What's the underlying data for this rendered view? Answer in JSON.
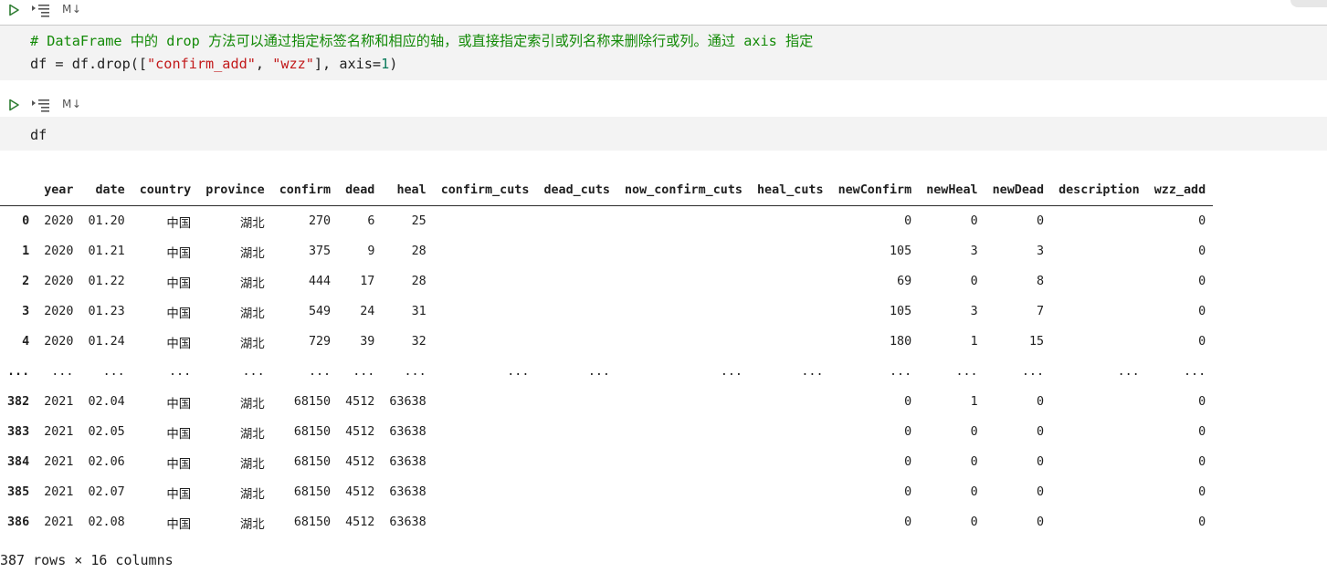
{
  "toolbar": {
    "md_label": "M↓"
  },
  "cell1": {
    "comment": "# DataFrame 中的 drop 方法可以通过指定标签名称和相应的轴，或直接指定索引或列名称来删除行或列。通过 axis 指定",
    "code_prefix": "df = df.drop([",
    "str1": "\"confirm_add\"",
    "sep": ", ",
    "str2": "\"wzz\"",
    "code_mid": "], axis=",
    "num": "1",
    "code_end": ")"
  },
  "cell2": {
    "code": "df"
  },
  "table": {
    "columns": [
      "",
      "year",
      "date",
      "country",
      "province",
      "confirm",
      "dead",
      "heal",
      "confirm_cuts",
      "dead_cuts",
      "now_confirm_cuts",
      "heal_cuts",
      "newConfirm",
      "newHeal",
      "newDead",
      "description",
      "wzz_add"
    ],
    "rows": [
      [
        "0",
        "2020",
        "01.20",
        "中国",
        "湖北",
        "270",
        "6",
        "25",
        "",
        "",
        "",
        "",
        "0",
        "0",
        "0",
        "",
        "0"
      ],
      [
        "1",
        "2020",
        "01.21",
        "中国",
        "湖北",
        "375",
        "9",
        "28",
        "",
        "",
        "",
        "",
        "105",
        "3",
        "3",
        "",
        "0"
      ],
      [
        "2",
        "2020",
        "01.22",
        "中国",
        "湖北",
        "444",
        "17",
        "28",
        "",
        "",
        "",
        "",
        "69",
        "0",
        "8",
        "",
        "0"
      ],
      [
        "3",
        "2020",
        "01.23",
        "中国",
        "湖北",
        "549",
        "24",
        "31",
        "",
        "",
        "",
        "",
        "105",
        "3",
        "7",
        "",
        "0"
      ],
      [
        "4",
        "2020",
        "01.24",
        "中国",
        "湖北",
        "729",
        "39",
        "32",
        "",
        "",
        "",
        "",
        "180",
        "1",
        "15",
        "",
        "0"
      ],
      [
        "...",
        "...",
        "...",
        "...",
        "...",
        "...",
        "...",
        "...",
        "...",
        "...",
        "...",
        "...",
        "...",
        "...",
        "...",
        "...",
        "..."
      ],
      [
        "382",
        "2021",
        "02.04",
        "中国",
        "湖北",
        "68150",
        "4512",
        "63638",
        "",
        "",
        "",
        "",
        "0",
        "1",
        "0",
        "",
        "0"
      ],
      [
        "383",
        "2021",
        "02.05",
        "中国",
        "湖北",
        "68150",
        "4512",
        "63638",
        "",
        "",
        "",
        "",
        "0",
        "0",
        "0",
        "",
        "0"
      ],
      [
        "384",
        "2021",
        "02.06",
        "中国",
        "湖北",
        "68150",
        "4512",
        "63638",
        "",
        "",
        "",
        "",
        "0",
        "0",
        "0",
        "",
        "0"
      ],
      [
        "385",
        "2021",
        "02.07",
        "中国",
        "湖北",
        "68150",
        "4512",
        "63638",
        "",
        "",
        "",
        "",
        "0",
        "0",
        "0",
        "",
        "0"
      ],
      [
        "386",
        "2021",
        "02.08",
        "中国",
        "湖北",
        "68150",
        "4512",
        "63638",
        "",
        "",
        "",
        "",
        "0",
        "0",
        "0",
        "",
        "0"
      ]
    ]
  },
  "summary": "387 rows × 16 columns",
  "colors": {
    "run_icon": "#2e7d32",
    "comment": "#138a07",
    "string": "#c2191a",
    "number": "#0a7a5a",
    "cell_bg": "#f3f3f3"
  }
}
